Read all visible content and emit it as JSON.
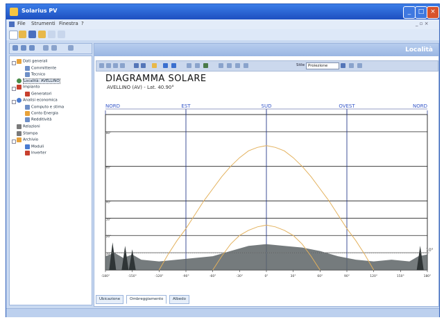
{
  "window": {
    "title": "Solarius PV"
  },
  "menu": {
    "items": [
      "File",
      "Strumenti",
      "Finestra",
      "?"
    ]
  },
  "tree": {
    "items": [
      {
        "label": "Dati generali",
        "color": "#e8a23a"
      },
      {
        "label": "Committente",
        "color": "#6e8fc7"
      },
      {
        "label": "Tecnico",
        "color": "#6e8fc7"
      },
      {
        "label": "Località: AVELLINO",
        "color": "#4a8c4a"
      },
      {
        "label": "Impianto",
        "color": "#c8402e"
      },
      {
        "label": "Generatori",
        "color": "#c8402e"
      },
      {
        "label": "Analisi economica",
        "color": "#4a7bd0"
      },
      {
        "label": "Computo e stima",
        "color": "#6e8fc7"
      },
      {
        "label": "Conto Energia",
        "color": "#e8a23a"
      },
      {
        "label": "Redditività",
        "color": "#6e8fc7"
      },
      {
        "label": "Relazioni",
        "color": "#7a7a7a"
      },
      {
        "label": "Stampa",
        "color": "#7a7a7a"
      },
      {
        "label": "Archivio",
        "color": "#e8a23a"
      },
      {
        "label": "Moduli",
        "color": "#4a7bd0"
      },
      {
        "label": "Inverter",
        "color": "#c8402e"
      }
    ]
  },
  "panel": {
    "header": "Località"
  },
  "chart_toolbar": {
    "label": "Stile",
    "select_value": "Proiezione"
  },
  "chart_data": {
    "type": "line",
    "title": "DIAGRAMMA SOLARE",
    "subtitle": "AVELLINO (AV) - Lat. 40.90°",
    "directions": [
      "NORD",
      "EST",
      "SUD",
      "OVEST",
      "NORD"
    ],
    "xlim": [
      -180,
      180
    ],
    "ylim": [
      0,
      90
    ],
    "x_ticks": [
      "-180°",
      "-150°",
      "-120°",
      "-90°",
      "-60°",
      "-30°",
      "0°",
      "30°",
      "60°",
      "90°",
      "120°",
      "150°",
      "180°"
    ],
    "y_ticks": [
      "10°",
      "20°",
      "30°",
      "40°",
      "60°",
      "80°"
    ],
    "horizon_label": "10°",
    "series": [
      {
        "x": [
          -120,
          -110,
          -100,
          -90,
          -80,
          -70,
          -60,
          -50,
          -40,
          -30,
          -20,
          -10,
          0,
          10,
          20,
          30,
          40,
          50,
          60,
          70,
          80,
          90,
          100,
          110,
          120
        ],
        "y": [
          0,
          9,
          17,
          24,
          32,
          40,
          47,
          54,
          60,
          65,
          69,
          71,
          72,
          71,
          69,
          65,
          60,
          54,
          47,
          40,
          32,
          24,
          17,
          9,
          0
        ],
        "color": "#e3b15c"
      },
      {
        "x": [
          -60,
          -50,
          -40,
          -30,
          -20,
          -10,
          0,
          10,
          20,
          30,
          40,
          50,
          60
        ],
        "y": [
          0,
          8,
          15,
          20,
          23,
          25,
          26,
          25,
          23,
          20,
          15,
          8,
          0
        ],
        "color": "#e3b15c"
      }
    ],
    "grid": true
  },
  "tabs": [
    {
      "label": "Ubicazione"
    },
    {
      "label": "Ombreggiamento"
    },
    {
      "label": "Albedo"
    }
  ]
}
